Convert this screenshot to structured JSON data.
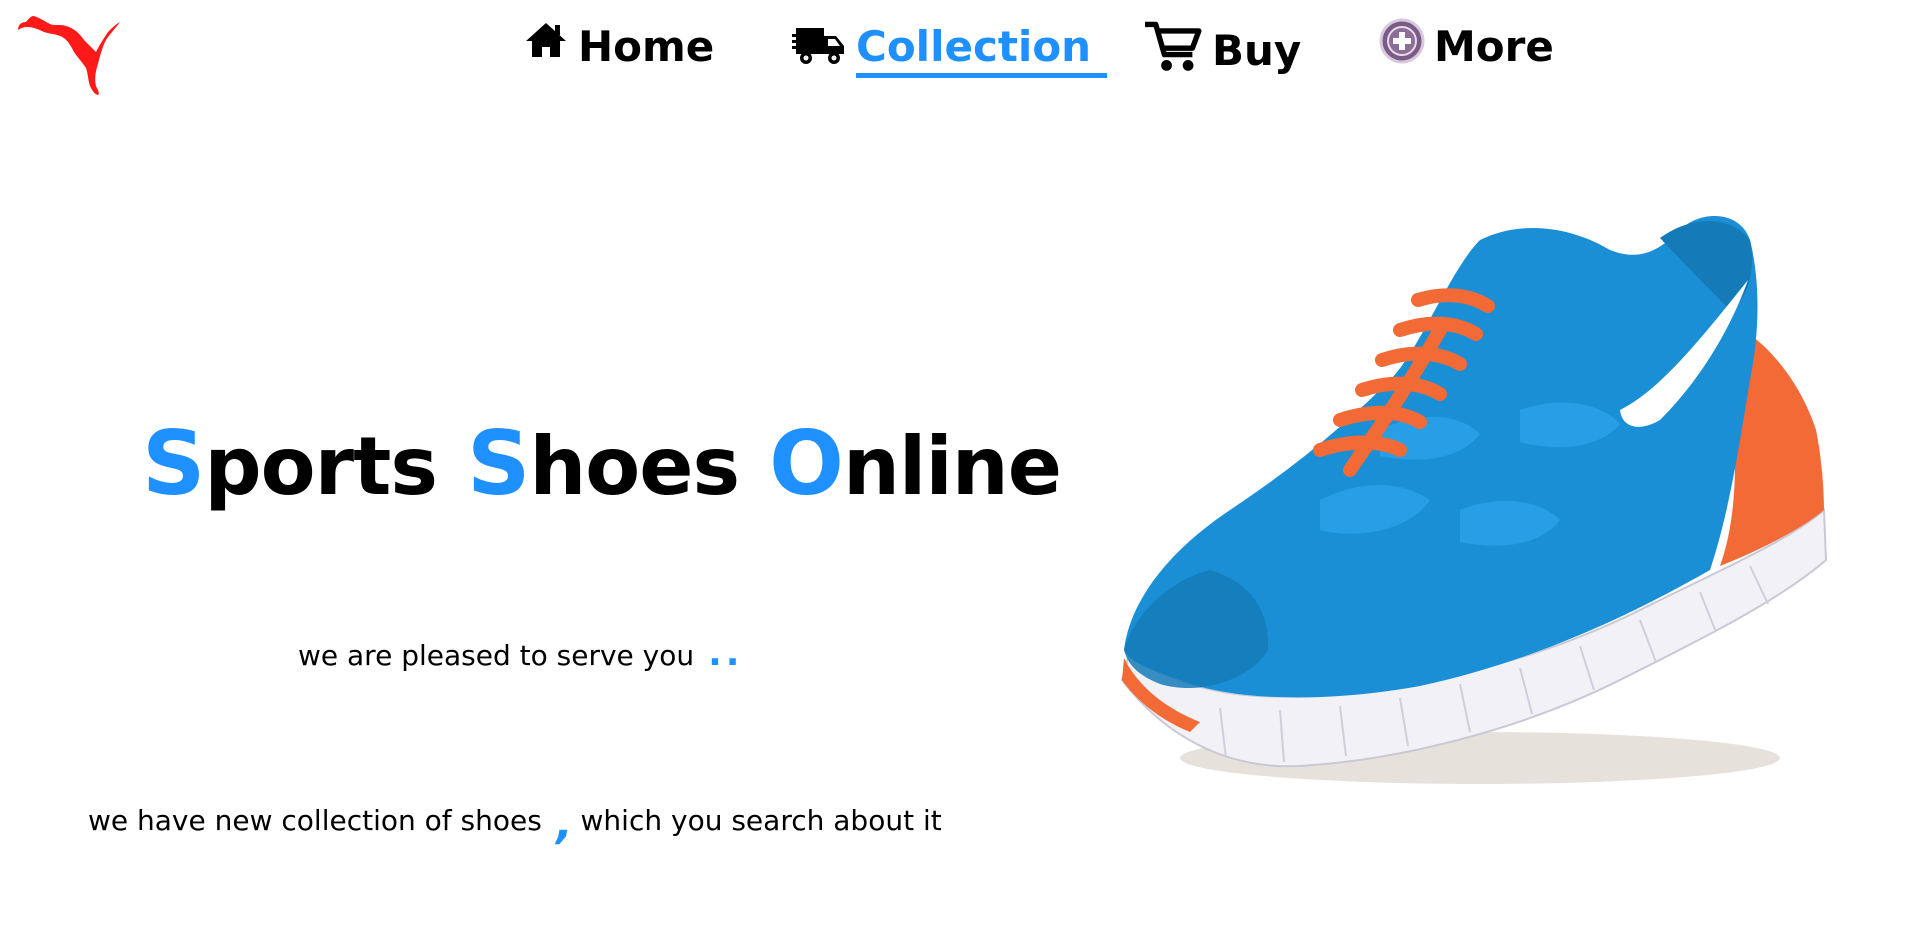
{
  "brand": {
    "logo_icon": "puma-logo-icon",
    "logo_color": "#ff1a1a"
  },
  "nav": {
    "items": [
      {
        "label": "Home",
        "icon": "house-icon",
        "active": false
      },
      {
        "label": "Collection",
        "icon": "delivery-truck-icon",
        "active": true
      },
      {
        "label": "Buy",
        "icon": "shopping-cart-icon",
        "active": false
      },
      {
        "label": "More",
        "icon": "plus-circle-icon",
        "active": false
      }
    ],
    "active_color": "#1e90ff"
  },
  "hero": {
    "title_words": [
      {
        "initial": "S",
        "rest": "ports"
      },
      {
        "initial": "S",
        "rest": "hoes"
      },
      {
        "initial": "O",
        "rest": "nline"
      }
    ],
    "accent_color": "#1e90ff",
    "tagline": "we are pleased to serve you",
    "tagline_mark": "..",
    "subline_part1": "we have new collection of shoes",
    "subline_mark": ",",
    "subline_part2": "which you search about it"
  },
  "product_image": {
    "icon": "running-shoe-image",
    "colors": {
      "upper": "#1a8fd6",
      "laces": "#f26a35",
      "sole": "#f2f2f7",
      "swoosh": "#ffffff"
    }
  }
}
